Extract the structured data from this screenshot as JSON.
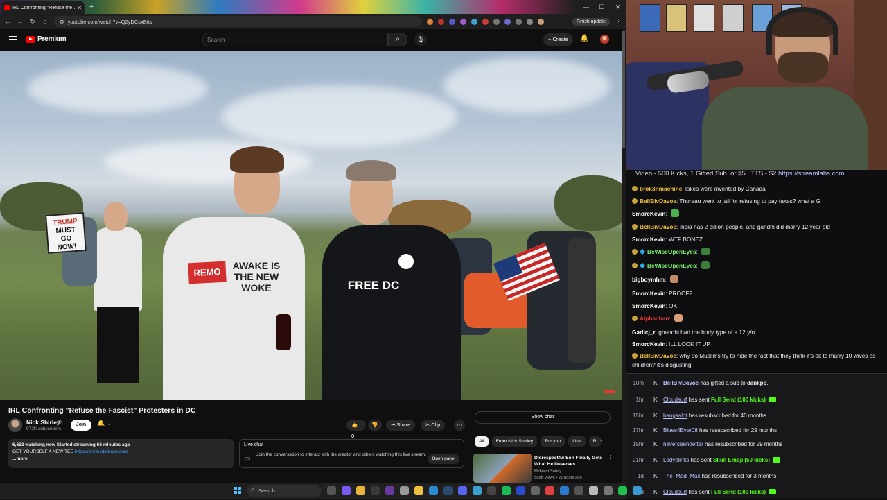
{
  "browser": {
    "tab_title": "IRL Confronting \"Refuse the…",
    "tab_close": "✕",
    "new_tab": "+",
    "window_controls": [
      "—",
      "☐",
      "✕"
    ],
    "nav": [
      "←",
      "→",
      "↻",
      "⌂"
    ],
    "url": "youtube.com/watch?v=Q2yDCsxBtts",
    "finish_update": "Finish update"
  },
  "youtube": {
    "brand": "Premium",
    "search_placeholder": "Search",
    "search_icon": "⌕",
    "mic_icon": "🎙",
    "create_label": "+ Create",
    "bell_icon": "🔔"
  },
  "video": {
    "sign_line1": "TRUMP",
    "sign_line2": "MUST",
    "sign_line3": "GO",
    "sign_line4": "NOW!",
    "sign2": "REMO",
    "shirt1": "AWAKE IS THE NEW WOKE",
    "shirt2": "FREE DC"
  },
  "meta": {
    "title": "IRL Confronting \"Refuse the Fascist\" Protesters in DC",
    "channel_name": "Nick Shirley",
    "verified": "◉",
    "subscribers": "972K subscribers",
    "join": "Join",
    "notify": "🔔 ⌄",
    "like": "👍 0",
    "dislike": "👎",
    "share": "↪ Share",
    "clip": "✂ Clip",
    "more": "⋯",
    "desc_line1": "6,653 watching now  Started streaming 66 minutes ago",
    "desc_line2_prefix": "GET YOURSELF A NEW TEE ",
    "desc_link": "https://shirleydefense.com",
    "desc_more": "...more",
    "live_chat_title": "Live chat",
    "live_chat_text": "Join the conversation to interact with the creator and others watching this live stream.",
    "open_panel": "Open panel",
    "show_chat": "Show chat",
    "chips": [
      "All",
      "From Nick Shirley",
      "For you",
      "Live",
      "R"
    ],
    "chips_arrow": "›",
    "rec_title": "Disrespectful Son Finally Gets What He Deserves",
    "rec_channel": "Midwest Safety",
    "rec_meta": "588K views • 22 hours ago",
    "rec_more": "⋮"
  },
  "stream": {
    "ticker": "Video - 500 Kicks, 1 Gifted Sub, or $5 | TTS - $2 ",
    "ticker_link": "https://streamlabs.com...",
    "chat": [
      {
        "user": "brok3nmachine",
        "text": "lakes were invented by Canada",
        "color": "#f0c040",
        "badge": 1
      },
      {
        "user": "BellBivDavoe",
        "text": "Thoreau went to jail for refusing to pay taxes? what a G",
        "color": "#f0c040",
        "badge": 1
      },
      {
        "user": "SmorcKevin",
        "text": "",
        "color": "#ffffff",
        "badge": 0,
        "emote": "#4caf50"
      },
      {
        "user": "BellBivDavoe",
        "text": "India has 2 billion people. and gandhi did marry 12 year old",
        "color": "#f0c040",
        "badge": 1
      },
      {
        "user": "SmorcKevin",
        "text": "WTF BONEZ",
        "color": "#ffffff",
        "badge": 0
      },
      {
        "user": "BeWiseOpenEyes",
        "text": "",
        "color": "#7cf06b",
        "badge": 2,
        "emote": "#3b7f3b"
      },
      {
        "user": "BeWiseOpenEyes",
        "text": "",
        "color": "#7cf06b",
        "badge": 2,
        "emote": "#3b7f3b"
      },
      {
        "user": "bigboymhm",
        "text": "",
        "color": "#ffffff",
        "badge": 0,
        "emote": "#c58a6a"
      },
      {
        "user": "SmorcKevin",
        "text": "PROOF?",
        "color": "#ffffff",
        "badge": 0
      },
      {
        "user": "SmorcKevin",
        "text": "OK",
        "color": "#ffffff",
        "badge": 0
      },
      {
        "user": "Alphachan",
        "text": "",
        "color": "#e53935",
        "badge": 1,
        "emote": "#d9a07a"
      },
      {
        "user": "Garlicj_r",
        "text": "ghandhi had the body type of a 12 y/o",
        "color": "#ffffff",
        "badge": 0
      },
      {
        "user": "SmorcKevin",
        "text": "ILL LOOK IT UP",
        "color": "#ffffff",
        "badge": 0
      },
      {
        "user": "BellBivDavoe",
        "text": "why do Muslims try to hide the fact that they think it's ok to marry 10 wives as children? it's disgusting",
        "color": "#f0c040",
        "badge": 1
      }
    ],
    "events": [
      {
        "time": "10m",
        "user": "BellBivDavoe",
        "action": " has gifted a sub to ",
        "target": "dankpp",
        "tail": ".",
        "gem": false,
        "link": false
      },
      {
        "time": "1hr",
        "user": "Cloudsurf",
        "action": " has sent ",
        "target": "Full Send (100 kicks)",
        "tail": "",
        "gem": true,
        "link": true
      },
      {
        "time": "15hr",
        "user": "bangsalot",
        "action": " has resubscribed for 40 months",
        "target": "",
        "tail": "",
        "gem": false,
        "link": true
      },
      {
        "time": "17hr",
        "user": "Blues4Ever08",
        "action": " has resubscribed for 29 months",
        "target": "",
        "tail": "",
        "gem": false,
        "link": true
      },
      {
        "time": "19hr",
        "user": "neverseenbetter",
        "action": " has resubscribed for 29 months",
        "target": "",
        "tail": "",
        "gem": false,
        "link": true
      },
      {
        "time": "21hr",
        "user": "Ladyclinks",
        "action": " has sent ",
        "target": "Skull Emoji (50 kicks)",
        "tail": "",
        "gem": true,
        "link": true
      },
      {
        "time": "1d",
        "user": "The_Mad_Max",
        "action": " has resubscribed for 3 months",
        "target": "",
        "tail": "",
        "gem": false,
        "link": true
      },
      {
        "time": "1d",
        "user": "Cloudsurf",
        "action": " has sent ",
        "target": "Full Send (100 kicks)",
        "tail": "",
        "gem": true,
        "link": true
      }
    ]
  },
  "taskbar": {
    "search": "Search",
    "search_icon": "⌕"
  }
}
